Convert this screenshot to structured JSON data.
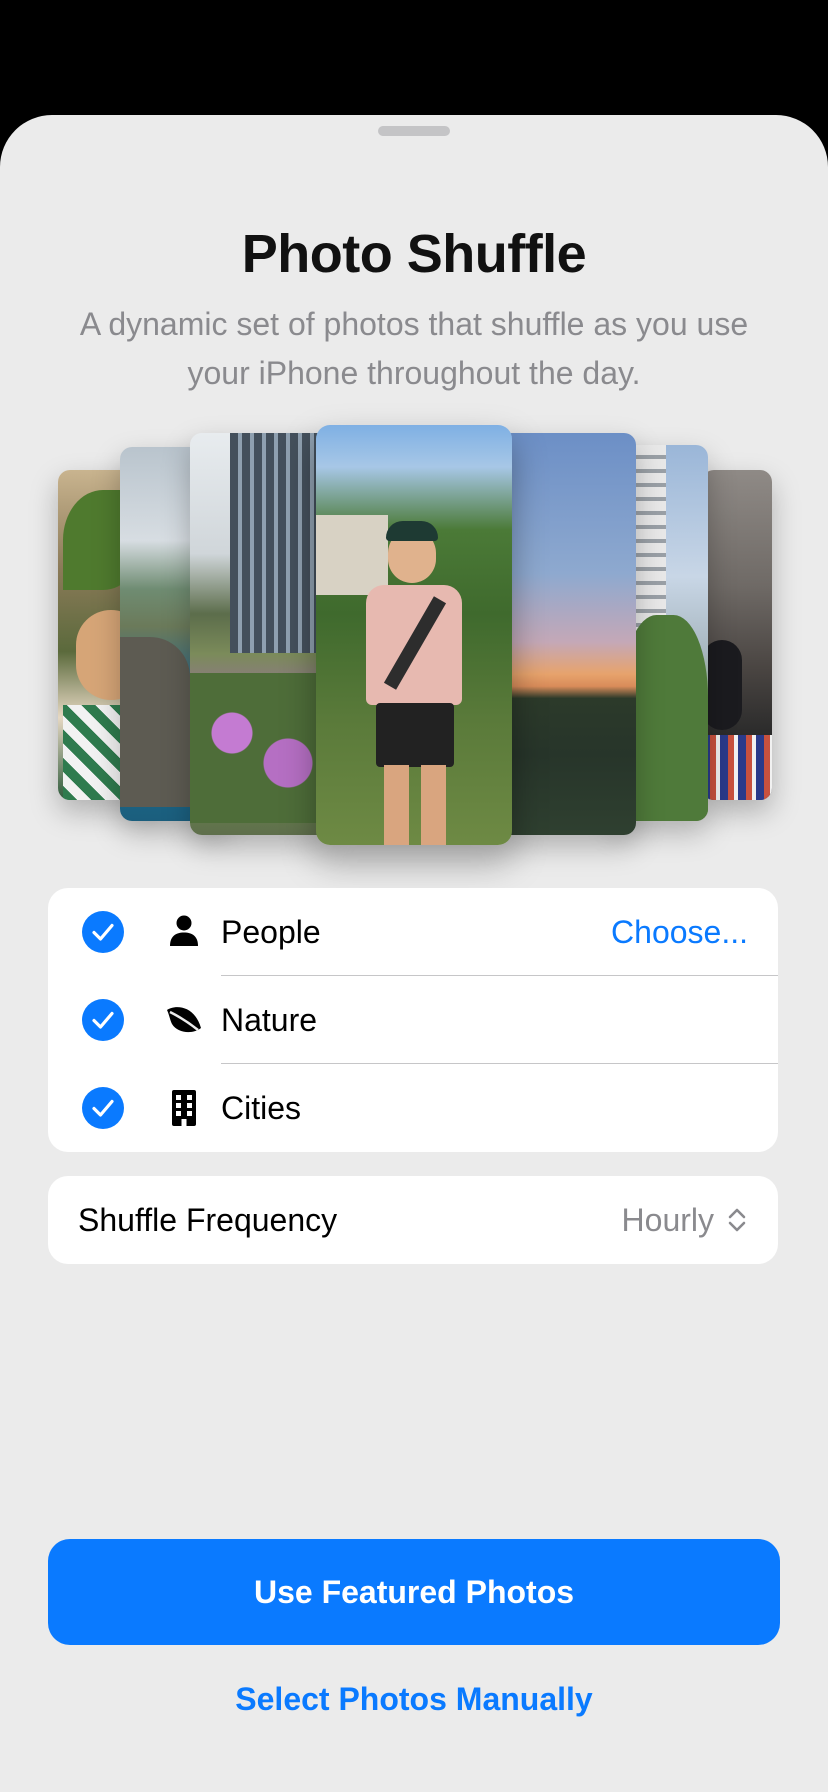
{
  "sheet": {
    "title": "Photo Shuffle",
    "subtitle": "A dynamic set of photos that shuffle as you use your iPhone throughout the day."
  },
  "categories": [
    {
      "label": "People",
      "icon": "person-icon",
      "checked": true,
      "action": "Choose..."
    },
    {
      "label": "Nature",
      "icon": "leaf-icon",
      "checked": true
    },
    {
      "label": "Cities",
      "icon": "building-icon",
      "checked": true
    }
  ],
  "frequency": {
    "label": "Shuffle Frequency",
    "value": "Hourly",
    "icon": "chevron-up-down-icon"
  },
  "buttons": {
    "primary": "Use Featured Photos",
    "secondary": "Select Photos Manually"
  },
  "colors": {
    "accent": "#0a7aff",
    "sheet_background": "#ebebeb",
    "secondary_text": "#8a8a8e"
  }
}
